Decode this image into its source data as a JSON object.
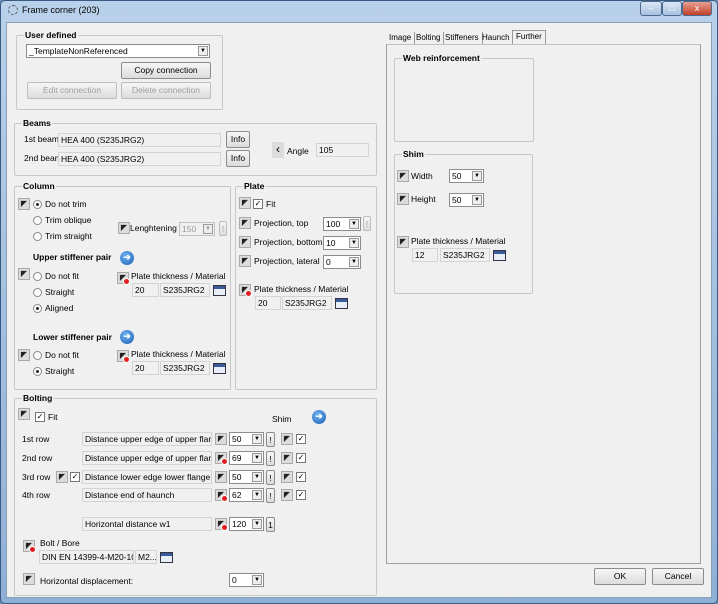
{
  "window": {
    "title": "Frame corner  (203)",
    "minimize": "–",
    "maximize": "□",
    "close": "x"
  },
  "user_defined": {
    "legend": "User defined",
    "template": "_TemplateNonReferenced",
    "copy": "Copy connection",
    "edit": "Edit connection",
    "delete": "Delete connection"
  },
  "beams": {
    "legend": "Beams",
    "beam1_label": "1st beam",
    "beam1": "HEA 400  (S235JRG2)",
    "beam2_label": "2nd beam",
    "beam2": "HEA 400  (S235JRG2)",
    "info": "Info",
    "angle_label": "Angle",
    "angle": "105"
  },
  "column": {
    "legend": "Column",
    "trim": [
      "Do not trim",
      "Trim oblique",
      "Trim straight"
    ],
    "trim_selected": "Do not trim",
    "lengthening_label": "Lenghtening",
    "lengthening": "150",
    "upper_label": "Upper stiffener pair",
    "upper_options": [
      "Do not fit",
      "Straight",
      "Aligned"
    ],
    "upper_selected": "Aligned",
    "upper_pt_label": "Plate thickness / Material",
    "upper_thickness": "20",
    "upper_material": "S235JRG2",
    "lower_label": "Lower stiffener pair",
    "lower_options": [
      "Do not fit",
      "Straight"
    ],
    "lower_selected": "Straight",
    "lower_pt_label": "Plate thickness / Material",
    "lower_thickness": "20",
    "lower_material": "S235JRG2"
  },
  "plate": {
    "legend": "Plate",
    "fit": "Fit",
    "proj_top_label": "Projection, top",
    "proj_top": "100",
    "proj_bottom_label": "Projection, bottom",
    "proj_bottom": "10",
    "proj_lateral_label": "Projection, lateral",
    "proj_lateral": "0",
    "pt_label": "Plate thickness / Material",
    "thickness": "20",
    "material": "S235JRG2"
  },
  "bolting": {
    "legend": "Bolting",
    "fit": "Fit",
    "shim": "Shim",
    "rows": [
      {
        "label": "1st row",
        "desc": "Distance upper edge of upper flange",
        "value": "50",
        "checked": true
      },
      {
        "label": "2nd row",
        "desc": "Distance upper edge of upper flange",
        "value": "69",
        "checked": true
      },
      {
        "label": "3rd row",
        "desc": "Distance lower edge lower flange",
        "value": "50",
        "checked": true
      },
      {
        "label": "4th row",
        "desc": "Distance end of haunch",
        "value": "62",
        "checked": true
      }
    ],
    "excl": "!",
    "hdist_label": "Horizontal distance w1",
    "hdist": "120",
    "hdist_btn": "1",
    "bolt_label": "Bolt / Bore",
    "bolt": "DIN  EN 14399-4-M20-10...",
    "bore": "M2...",
    "hdisp_label": "Horizontal displacement:",
    "hdisp": "0"
  },
  "tabs": [
    {
      "label": "Image"
    },
    {
      "label": "Bolting"
    },
    {
      "label": "Stiffeners"
    },
    {
      "label": "Haunch"
    },
    {
      "label": "Further",
      "selected": true
    }
  ],
  "further": {
    "web_legend": "Web reinforcement",
    "shim_legend": "Shim",
    "width_label": "Width",
    "width": "50",
    "height_label": "Height",
    "height": "50",
    "pt_label": "Plate thickness / Material",
    "thickness": "12",
    "material": "S235JRG2"
  },
  "footer": {
    "ok": "OK",
    "cancel": "Cancel"
  }
}
